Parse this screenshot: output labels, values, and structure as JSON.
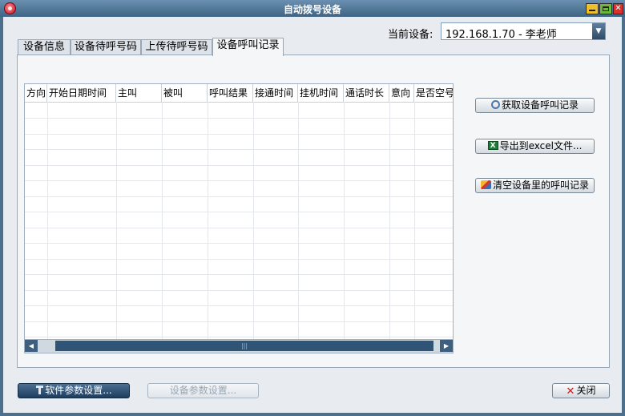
{
  "window": {
    "title": "自动拨号设备"
  },
  "device": {
    "label": "当前设备:",
    "selected": "192.168.1.70 - 李老师"
  },
  "tabs": [
    {
      "label": "设备信息",
      "active": false
    },
    {
      "label": "设备待呼号码",
      "active": false
    },
    {
      "label": "上传待呼号码",
      "active": false
    },
    {
      "label": "设备呼叫记录",
      "active": true
    }
  ],
  "table": {
    "columns": [
      "方向",
      "开始日期时间",
      "主叫",
      "被叫",
      "呼叫结果",
      "接通时间",
      "挂机时间",
      "通话时长",
      "意向",
      "是否空号"
    ],
    "rows": []
  },
  "actions": {
    "fetch": {
      "label": "获取设备呼叫记录",
      "icon": "search-icon"
    },
    "export": {
      "label": "导出到excel文件...",
      "icon": "excel-icon"
    },
    "clear": {
      "label": "清空设备里的呼叫记录",
      "icon": "clear-icon"
    }
  },
  "footer": {
    "software_settings": "软件参数设置...",
    "device_settings": "设备参数设置...",
    "close": "关闭"
  }
}
